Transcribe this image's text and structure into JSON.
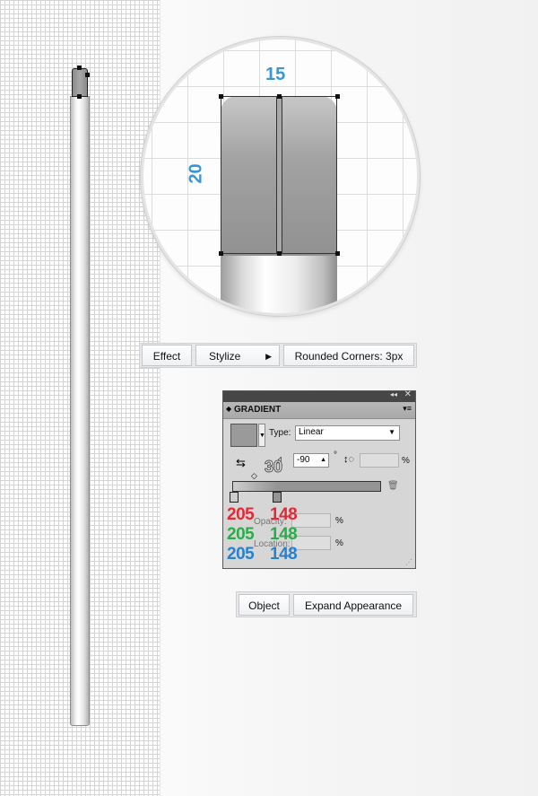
{
  "dimensions": {
    "width": "15",
    "height": "20"
  },
  "effect_menu": {
    "effect": "Effect",
    "stylize": "Stylize",
    "rounded": "Rounded Corners: 3px"
  },
  "gradient_panel": {
    "title": "GRADIENT",
    "type_label": "Type:",
    "type_value": "Linear",
    "angle_value": "-90",
    "angle_unit": "°",
    "angle_callout": "30",
    "percent": "%",
    "opacity_label": "Opacity:",
    "location_label": "Location:"
  },
  "color_values": {
    "red": [
      "205",
      "148"
    ],
    "green": [
      "205",
      "148"
    ],
    "blue": [
      "205",
      "148"
    ]
  },
  "colors": {
    "red": "#e02a36",
    "green": "#2dab4a",
    "blue": "#2a80c9",
    "dimension": "#3a95d3"
  },
  "object_menu": {
    "object": "Object",
    "expand": "Expand Appearance"
  }
}
